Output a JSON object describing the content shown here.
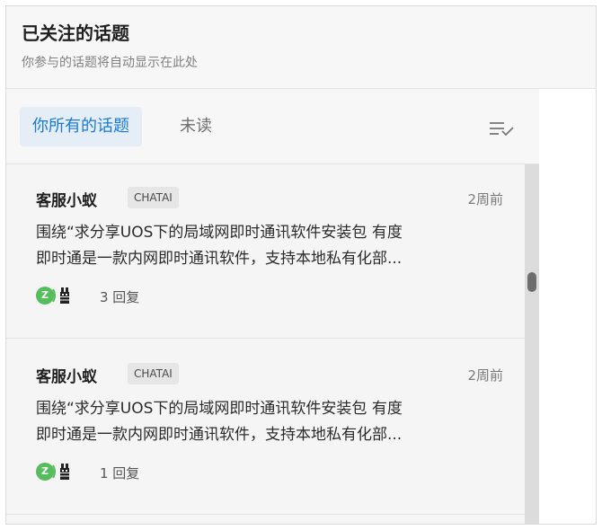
{
  "header": {
    "title": "已关注的话题",
    "subtitle": "你参与的话题将自动显示在此处"
  },
  "tabs": [
    {
      "label": "你所有的话题",
      "active": true
    },
    {
      "label": "未读",
      "active": false
    }
  ],
  "sort_icon": "sort-icon",
  "topics": [
    {
      "author": "客服小蚁",
      "tag": "CHATAI",
      "time": "2周前",
      "excerpt_line1": "围绕“求分享UOS下的局域网即时通讯软件安装包 有度",
      "excerpt_line2": "即时通是一款内网即时通讯软件，支持本地私有化部...",
      "avatar_letter": "Z",
      "replies": "3 回复"
    },
    {
      "author": "客服小蚁",
      "tag": "CHATAI",
      "time": "2周前",
      "excerpt_line1": "围绕“求分享UOS下的局域网即时通讯软件安装包 有度",
      "excerpt_line2": "即时通是一款内网即时通讯软件，支持本地私有化部...",
      "avatar_letter": "Z",
      "replies": "1 回复"
    }
  ],
  "colors": {
    "accent": "#1a7ad1",
    "active_tab_bg": "#e5eef7",
    "avatar_green": "#56bd5d"
  }
}
